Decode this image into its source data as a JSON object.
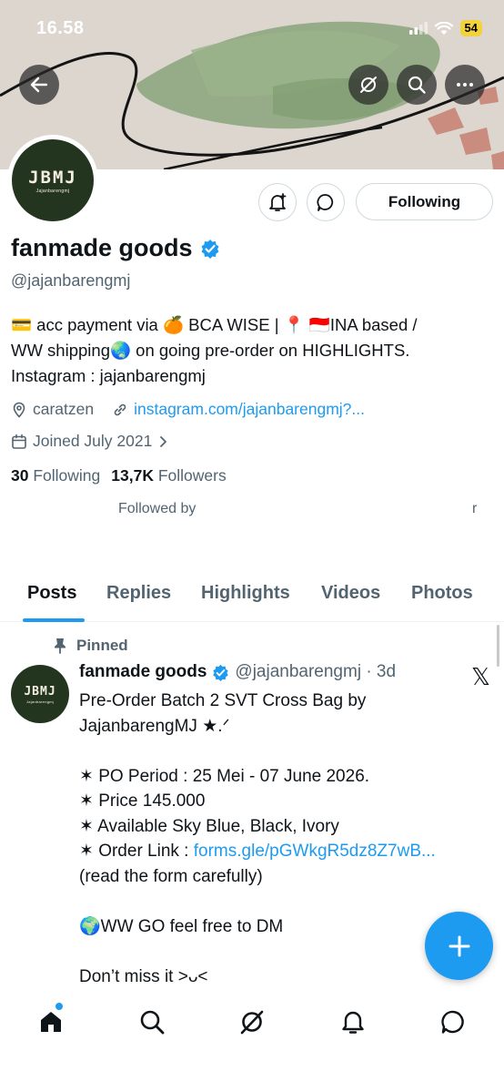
{
  "status_bar": {
    "time": "16.58",
    "battery": "54"
  },
  "profile": {
    "avatar_text": "JBMJ",
    "avatar_subtext": "Jajanbarengmj",
    "display_name": "fanmade goods",
    "handle": "@jajanbarengmj",
    "following_button": "Following",
    "bio_line1": "💳 acc payment via 🍊 BCA WISE | 📍 🇮🇩INA based /",
    "bio_line2": "WW shipping🌏 on going pre-order on HIGHLIGHTS.",
    "bio_line3": "Instagram : jajanbarengmj",
    "location": "caratzen",
    "website": "instagram.com/jajanbarengmj?...",
    "joined": "Joined July 2021",
    "following_count": "30",
    "following_label": "Following",
    "followers_count": "13,7K",
    "followers_label": "Followers",
    "followed_by": "Followed by",
    "followed_by_tail": "r"
  },
  "tabs": [
    "Posts",
    "Replies",
    "Highlights",
    "Videos",
    "Photos"
  ],
  "post": {
    "pinned_label": "Pinned",
    "author": "fanmade goods",
    "handle_time": "@jajanbarengmj · 3d",
    "x_logo": "𝕏",
    "line1": "Pre-Order Batch 2 SVT Cross Bag by",
    "line2": "JajanbarengMJ ★.ᐟ",
    "line3": "✶ PO Period : 25 Mei - 07 June 2026.",
    "line4": "✶ Price 145.000",
    "line5": "✶ Available Sky Blue, Black, Ivory",
    "line6_prefix": "✶ Order Link : ",
    "line6_link": "forms.gle/pGWkgR5dz8Z7wB...",
    "line7": "(read the form carefully)",
    "line8": "🌍WW GO feel free to DM",
    "line9": "Don’t miss it >ᴗ<"
  },
  "colors": {
    "accent": "#1d9bf0",
    "text": "#0f1419",
    "secondary": "#536471",
    "avatar_bg": "#23351f"
  },
  "icons": [
    "back-arrow-icon",
    "grok-icon",
    "search-icon",
    "more-icon",
    "notification-bell-icon",
    "message-icon",
    "verified-badge-icon",
    "location-icon",
    "link-icon",
    "calendar-icon",
    "pin-icon",
    "plus-icon",
    "home-icon",
    "explore-icon",
    "bell-icon",
    "chat-icon"
  ]
}
